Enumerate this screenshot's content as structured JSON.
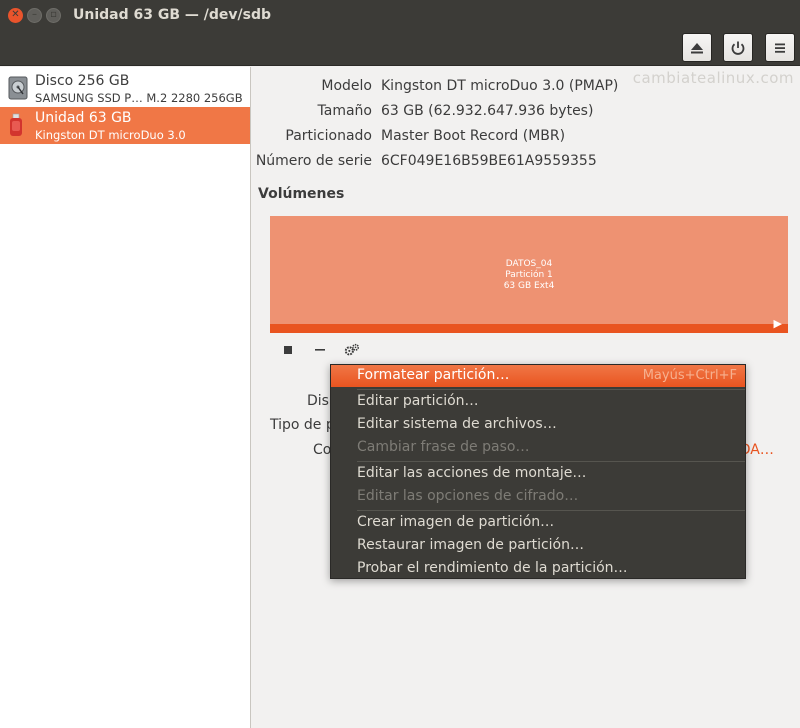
{
  "window": {
    "title": "Unidad 63 GB — /dev/sdb"
  },
  "watermark": "cambiatealinux.com",
  "drives": [
    {
      "name": "Disco 256 GB",
      "sub": "SAMSUNG SSD P… M.2 2280 256GB",
      "icon": "hard-disk-icon"
    },
    {
      "name": "Unidad 63 GB",
      "sub": "Kingston DT microDuo 3.0",
      "icon": "usb-drive-icon",
      "selected": true
    }
  ],
  "details": [
    {
      "label": "Modelo",
      "value": "Kingston DT microDuo 3.0 (PMAP)"
    },
    {
      "label": "Tamaño",
      "value": "63 GB (62.932.647.936 bytes)"
    },
    {
      "label": "Particionado",
      "value": "Master Boot Record (MBR)"
    },
    {
      "label": "Número de serie",
      "value": "6CF049E16B59BE61A9559355"
    }
  ],
  "volumes": {
    "title": "Volúmenes",
    "partition": {
      "name": "DATOS_04",
      "number": "Partición 1",
      "size": "63 GB Ext4"
    }
  },
  "partial_labels": {
    "device": "Dis",
    "type": "Tipo de p",
    "contents": "Co",
    "contents_link": "/DA…"
  },
  "menu": {
    "items": [
      {
        "label": "Formatear partición…",
        "shortcut": "Mayús+Ctrl+F",
        "highlighted": true
      },
      {
        "label": "Editar partición…"
      },
      {
        "label": "Editar sistema de archivos…"
      },
      {
        "label": "Cambiar frase de paso…",
        "disabled": true
      },
      {
        "label": "Editar las acciones de montaje…"
      },
      {
        "label": "Editar las opciones de cifrado…",
        "disabled": true
      },
      {
        "label": "Crear imagen de partición…"
      },
      {
        "label": "Restaurar imagen de partición…"
      },
      {
        "label": "Probar el rendimiento de la partición…"
      }
    ]
  },
  "colors": {
    "accent": "#e95420",
    "selection": "#f07746",
    "partition_fill": "#ee9272",
    "menu_bg": "#3c3b37"
  }
}
